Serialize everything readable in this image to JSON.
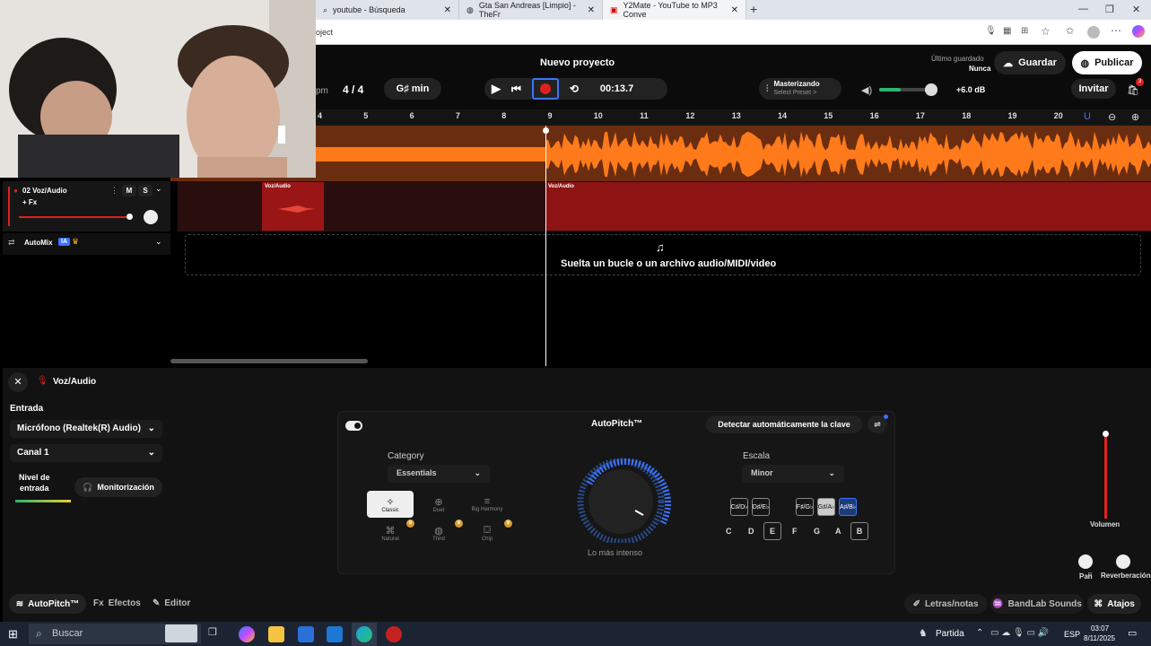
{
  "browser": {
    "tabs": [
      {
        "title": "youtube - Búsqueda"
      },
      {
        "title": "Gta San Andreas [Limpio] - TheFr"
      },
      {
        "title": "Y2Mate - YouTube to MP3 Conve"
      }
    ],
    "address": "oject",
    "new_tab": "+"
  },
  "header": {
    "project_title": "Nuevo proyecto",
    "bpm_suffix": "pm",
    "time_sig": "4 / 4",
    "key": "G♯ min",
    "time": "00:13.7",
    "mastering_title": "Masterizando",
    "mastering_sub": "Select Preset >",
    "volume_db": "+6.0 dB",
    "last_saved_label": "Último guardado",
    "last_saved_value": "Nunca",
    "save": "Guardar",
    "publish": "Publicar",
    "invite": "Invitar",
    "cart_badge": "3"
  },
  "ruler": [
    "4",
    "5",
    "6",
    "7",
    "8",
    "9",
    "10",
    "11",
    "12",
    "13",
    "14",
    "15",
    "16",
    "17",
    "18",
    "19",
    "20"
  ],
  "track": {
    "name": "02  Voz/Audio",
    "m": "M",
    "s": "S",
    "fx": "+ Fx",
    "clip1": "Voz/Audio",
    "clip2": "Voz/Audio",
    "automix": "AutoMix",
    "ia": "IA",
    "drop_text": "Suelta un bucle o un archivo audio/MIDI/video"
  },
  "panel": {
    "title": "Voz/Audio",
    "input_label": "Entrada",
    "input_device": "Micrófono (Realtek(R) Audio)",
    "channel": "Canal 1",
    "input_level": "Nivel de\nentrada",
    "monitoring": "Monitorización",
    "autopitch_title": "AutoPitch™",
    "detect_key": "Detectar automáticamente la clave",
    "category_label": "Category",
    "category_value": "Essentials",
    "presets": [
      "Classic",
      "Duet",
      "Big Harmony",
      "Natural",
      "Third",
      "Chip"
    ],
    "knob_label": "Lo más intenso",
    "scale_label": "Escala",
    "scale_value": "Minor",
    "sharp_keys": [
      [
        "C♯",
        "D♭"
      ],
      [
        "D♯",
        "E♭"
      ],
      [
        "F♯",
        "G♭"
      ],
      [
        "G♯",
        "A♭"
      ],
      [
        "A♯",
        "B♭"
      ]
    ],
    "notes": [
      "C",
      "D",
      "E",
      "F",
      "G",
      "A",
      "B"
    ],
    "volume_label": "Volumen",
    "pan_label": "Pan",
    "reverb_label": "Reverberación",
    "pan_lr": "L   R"
  },
  "bottom_tabs": {
    "autopitch": "AutoPitch™",
    "effects": "Efectos",
    "editor": "Editor",
    "lyrics": "Letras/notas",
    "sounds": "BandLab Sounds",
    "shortcuts": "Atajos"
  },
  "taskbar": {
    "search": "Buscar",
    "match": "Partida",
    "lang": "ESP",
    "time": "03:07",
    "date": "8/11/2025"
  },
  "colors": {
    "accent": "#e0201f",
    "brand": "#ff7a1a",
    "wave_bg": "#6b2d10",
    "clip": "#8e1414"
  }
}
